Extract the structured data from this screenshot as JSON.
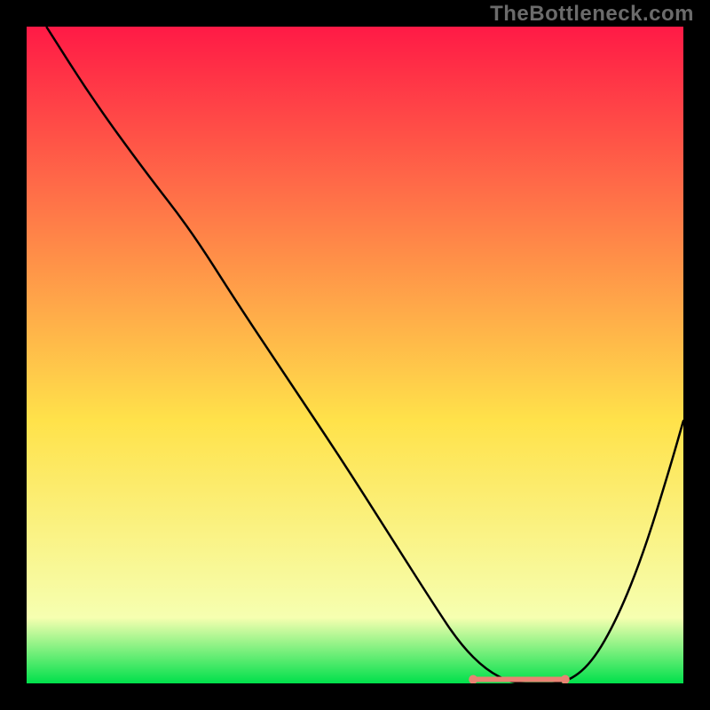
{
  "watermark": "TheBottleneck.com",
  "chart_data": {
    "type": "line",
    "title": "",
    "xlabel": "",
    "ylabel": "",
    "xlim": [
      0,
      100
    ],
    "ylim": [
      0,
      100
    ],
    "grid": false,
    "series": [
      {
        "name": "bottleneck-curve",
        "x": [
          3,
          10,
          18,
          25,
          32,
          40,
          48,
          55,
          62,
          66,
          70,
          74,
          78,
          82,
          86,
          90,
          94,
          98,
          100
        ],
        "y": [
          100,
          89,
          78,
          69,
          58,
          46,
          34,
          23,
          12,
          6,
          2,
          0,
          0,
          0,
          3,
          10,
          20,
          33,
          40
        ]
      }
    ],
    "markers": {
      "name": "optimal-points",
      "x": [
        68,
        70,
        72,
        73,
        74,
        75,
        76,
        77,
        78,
        80,
        82
      ],
      "y": [
        0.6,
        0.6,
        0.6,
        0.6,
        0.6,
        0.6,
        0.6,
        0.6,
        0.6,
        0.6,
        0.6
      ]
    },
    "gradient_colors": {
      "top": "#ff1a46",
      "yellow": "#ffe24a",
      "pale": "#f6ffb0",
      "green": "#00e04b"
    }
  }
}
